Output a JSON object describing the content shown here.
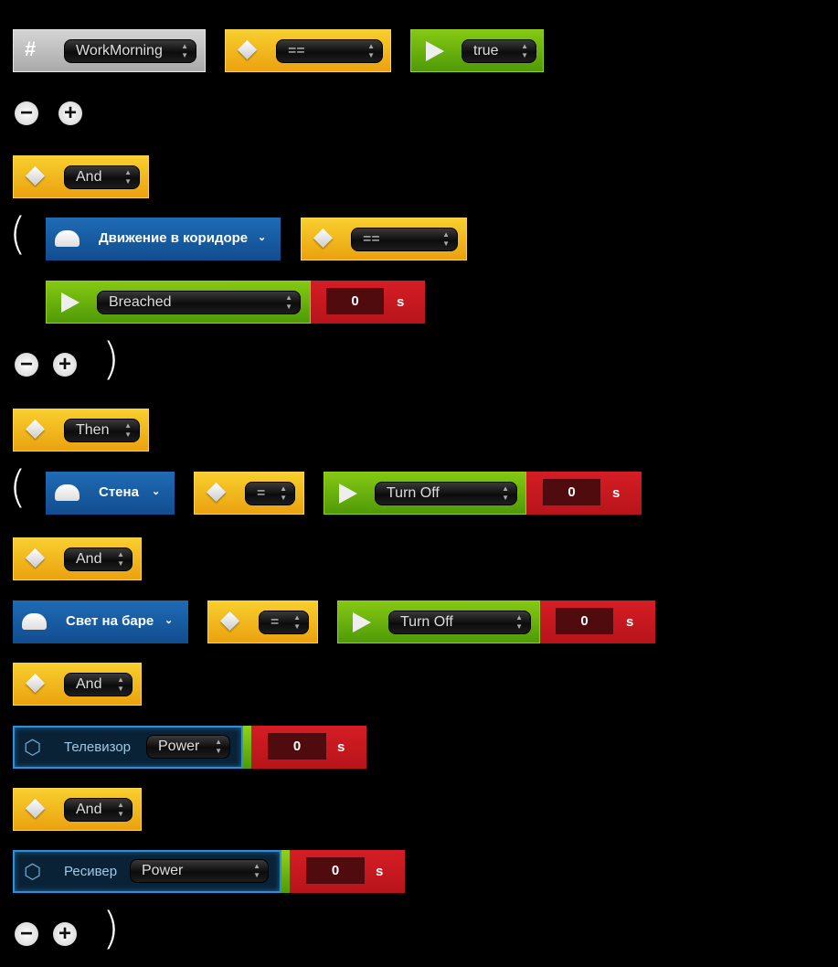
{
  "variable": {
    "icon": "hash-icon",
    "name": "WorkMorning",
    "operator": "==",
    "value": "true"
  },
  "logic": {
    "and": "And",
    "then": "Then"
  },
  "trigger": {
    "device": "Движение в коридоре",
    "operator": "==",
    "state": "Breached",
    "delay": "0",
    "unit": "s"
  },
  "actions": [
    {
      "device": "Стена",
      "operator": "=",
      "command": "Turn Off",
      "delay": "0",
      "unit": "s"
    },
    {
      "device": "Свет на баре",
      "operator": "=",
      "command": "Turn Off",
      "delay": "0",
      "unit": "s"
    },
    {
      "device": "Телевизор",
      "command": "Power",
      "delay": "0",
      "unit": "s"
    },
    {
      "device": "Ресивер",
      "command": "Power",
      "delay": "0",
      "unit": "s"
    }
  ],
  "controls": {
    "minus": "−",
    "plus": "+",
    "open_paren": "(",
    "close_paren": ")"
  }
}
